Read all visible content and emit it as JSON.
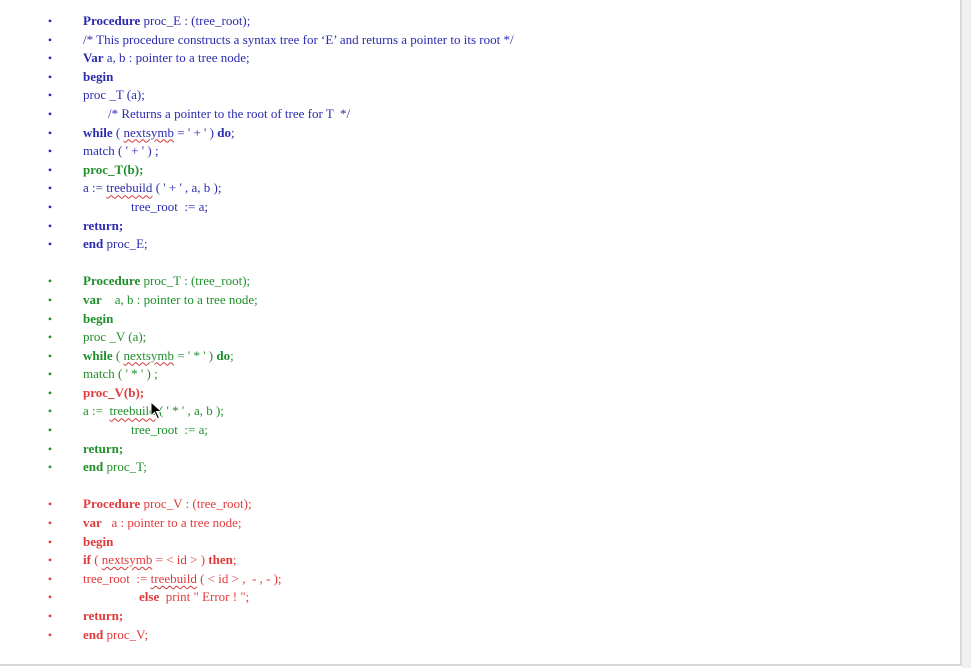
{
  "bullet_char": "•",
  "blocks": [
    {
      "color": "blue",
      "lines": [
        {
          "indent": 0,
          "segs": [
            {
              "t": "Procedure",
              "b": true
            },
            {
              "t": " proc_E : (tree_root);"
            }
          ]
        },
        {
          "indent": 0,
          "segs": [
            {
              "t": "/* This procedure constructs a syntax tree for ‘E’ and returns a pointer to its root */"
            }
          ]
        },
        {
          "indent": 0,
          "segs": [
            {
              "t": "Var",
              "b": true
            },
            {
              "t": " a, b : pointer to a tree node;"
            }
          ]
        },
        {
          "indent": 0,
          "segs": [
            {
              "t": "begin",
              "b": true
            }
          ]
        },
        {
          "indent": 0,
          "segs": [
            {
              "t": "proc _T (a);"
            }
          ]
        },
        {
          "indent": 1,
          "segs": [
            {
              "t": "/* Returns a pointer to the root of tree for T  */"
            }
          ]
        },
        {
          "indent": 0,
          "segs": [
            {
              "t": "while",
              "b": true
            },
            {
              "t": " ( "
            },
            {
              "t": "nextsymb",
              "sq": true
            },
            {
              "t": " = ' + ' ) "
            },
            {
              "t": "do",
              "b": true
            },
            {
              "t": ";"
            }
          ]
        },
        {
          "indent": 0,
          "segs": [
            {
              "t": "match ( ' + ' ) ;"
            }
          ]
        },
        {
          "indent": 0,
          "color": "green",
          "segs": [
            {
              "t": "proc_T(b);",
              "b": true
            }
          ]
        },
        {
          "indent": 0,
          "segs": [
            {
              "t": "a := "
            },
            {
              "t": "treebuild",
              "sq": true
            },
            {
              "t": " ( ' + ' , a, b );"
            }
          ]
        },
        {
          "indent": 2,
          "segs": [
            {
              "t": "tree_root  := a;"
            }
          ]
        },
        {
          "indent": 0,
          "segs": [
            {
              "t": "return;",
              "b": true
            }
          ]
        },
        {
          "indent": 0,
          "segs": [
            {
              "t": "end",
              "b": true
            },
            {
              "t": " proc_E;"
            }
          ]
        }
      ]
    },
    {
      "color": "green",
      "lines": [
        {
          "indent": 0,
          "segs": [
            {
              "t": "Procedure",
              "b": true
            },
            {
              "t": " proc_T : (tree_root);"
            }
          ]
        },
        {
          "indent": 0,
          "segs": [
            {
              "t": "var",
              "b": true
            },
            {
              "t": "    a, b : pointer to a tree node;"
            }
          ]
        },
        {
          "indent": 0,
          "segs": [
            {
              "t": "begin",
              "b": true
            }
          ]
        },
        {
          "indent": 0,
          "segs": [
            {
              "t": "proc _V (a);"
            }
          ]
        },
        {
          "indent": 0,
          "segs": [
            {
              "t": "while",
              "b": true
            },
            {
              "t": " ( "
            },
            {
              "t": "nextsymb",
              "sq": true
            },
            {
              "t": " = ' * ' ) "
            },
            {
              "t": "do",
              "b": true
            },
            {
              "t": ";"
            }
          ]
        },
        {
          "indent": 0,
          "segs": [
            {
              "t": "match ( ' * ' ) ;"
            }
          ]
        },
        {
          "indent": 0,
          "color": "red",
          "segs": [
            {
              "t": "proc_V(b);",
              "b": true
            }
          ]
        },
        {
          "indent": 0,
          "segs": [
            {
              "t": "a :=  "
            },
            {
              "t": "treebuild",
              "sq": true
            },
            {
              "t": " ( ' * ' , a, b );"
            }
          ]
        },
        {
          "indent": 2,
          "segs": [
            {
              "t": "tree_root  := a;"
            }
          ]
        },
        {
          "indent": 0,
          "segs": [
            {
              "t": "return;",
              "b": true
            }
          ]
        },
        {
          "indent": 0,
          "segs": [
            {
              "t": "end",
              "b": true
            },
            {
              "t": " proc_T;"
            }
          ]
        }
      ]
    },
    {
      "color": "red",
      "lines": [
        {
          "indent": 0,
          "segs": [
            {
              "t": "Procedure",
              "b": true
            },
            {
              "t": " proc_V : (tree_root);"
            }
          ]
        },
        {
          "indent": 0,
          "segs": [
            {
              "t": "var",
              "b": true
            },
            {
              "t": "   a : pointer to a tree node;"
            }
          ]
        },
        {
          "indent": 0,
          "segs": [
            {
              "t": "begin",
              "b": true
            }
          ]
        },
        {
          "indent": 0,
          "segs": [
            {
              "t": "if",
              "b": true
            },
            {
              "t": " ( "
            },
            {
              "t": "nextsymb",
              "sq": true
            },
            {
              "t": " = < id > ) "
            },
            {
              "t": "then",
              "b": true
            },
            {
              "t": ";"
            }
          ]
        },
        {
          "indent": 0,
          "segs": [
            {
              "t": "tree_root  := "
            },
            {
              "t": "treebuild",
              "sq": true
            },
            {
              "t": " ( < id > ,  - , - );"
            }
          ]
        },
        {
          "indent": 3,
          "segs": [
            {
              "t": "else",
              "b": true
            },
            {
              "t": "  print \" Error ! \";"
            }
          ]
        },
        {
          "indent": 0,
          "segs": [
            {
              "t": "return;",
              "b": true
            }
          ]
        },
        {
          "indent": 0,
          "segs": [
            {
              "t": "end",
              "b": true
            },
            {
              "t": " proc_V;"
            }
          ]
        }
      ]
    }
  ]
}
